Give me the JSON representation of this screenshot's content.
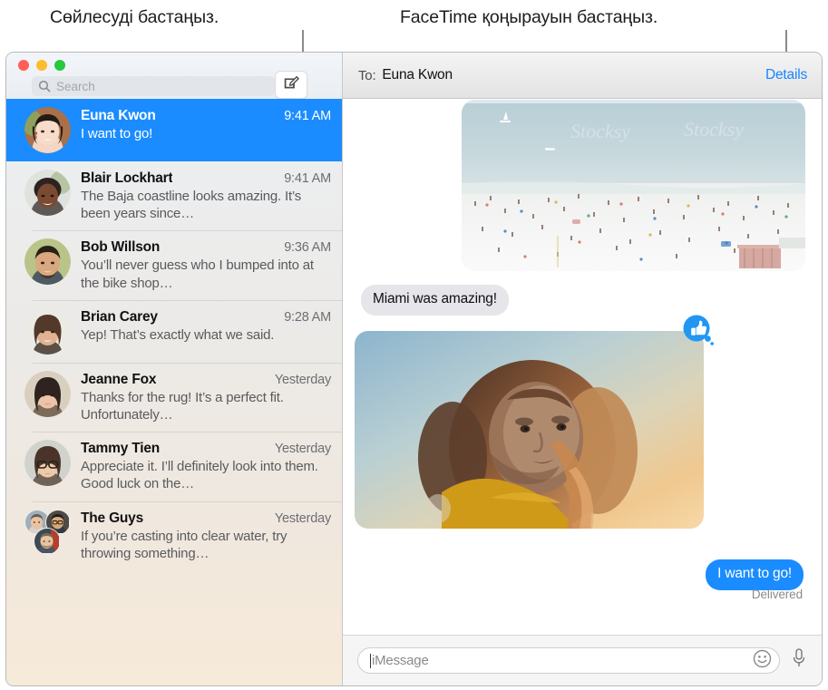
{
  "callouts": {
    "left": "Сөйлесуді бастаңыз.",
    "right": "FaceTime қоңырауын бастаңыз."
  },
  "window": {
    "traffic_lights": {
      "close_color": "#ff5f57",
      "minimize_color": "#febc2e",
      "zoom_color": "#28c840"
    }
  },
  "sidebar": {
    "search": {
      "placeholder": "Search",
      "icon": "search-icon"
    },
    "compose_button": {
      "icon": "compose-icon",
      "label": ""
    },
    "conversations": [
      {
        "name": "Euna Kwon",
        "time": "9:41 AM",
        "preview": "I want to go!",
        "selected": true,
        "avatar": "woman-dark-hair"
      },
      {
        "name": "Blair Lockhart",
        "time": "9:41 AM",
        "preview": "The Baja coastline looks amazing. It’s been years since…",
        "selected": false,
        "avatar": "woman-curly-hair"
      },
      {
        "name": "Bob Willson",
        "time": "9:36 AM",
        "preview": "You’ll never guess who I bumped into at the bike shop…",
        "selected": false,
        "avatar": "man-beard"
      },
      {
        "name": "Brian Carey",
        "time": "9:28 AM",
        "preview": "Yep! That’s exactly what we said.",
        "selected": false,
        "avatar": "man-long-hair"
      },
      {
        "name": "Jeanne Fox",
        "time": "Yesterday",
        "preview": "Thanks for the rug! It’s a perfect fit. Unfortunately…",
        "selected": false,
        "avatar": "woman-brown-hair"
      },
      {
        "name": "Tammy Tien",
        "time": "Yesterday",
        "preview": "Appreciate it. I’ll definitely look into them. Good luck on the…",
        "selected": false,
        "avatar": "woman-glasses"
      },
      {
        "name": "The Guys",
        "time": "Yesterday",
        "preview": "If you’re casting into clear water, try throwing something…",
        "selected": false,
        "avatar": "group-three-men"
      }
    ],
    "selection_color": "#1a8cff"
  },
  "conversation": {
    "to_label": "To:",
    "to_name": "Euna Kwon",
    "details_label": "Details",
    "details_color": "#1a84ff",
    "messages": [
      {
        "type": "photo",
        "side": "incoming",
        "description": "crowded-beach-photo"
      },
      {
        "type": "text",
        "side": "incoming",
        "text": "Miami was amazing!"
      },
      {
        "type": "photo",
        "side": "incoming",
        "description": "woman-sunset-portrait",
        "tapback": "thumbs-up"
      },
      {
        "type": "text",
        "side": "outgoing",
        "text": "I want to go!",
        "status": "Delivered"
      }
    ],
    "bubble_incoming_color": "#e5e5ea",
    "bubble_outgoing_color": "#1a8cff"
  },
  "input_bar": {
    "placeholder": "iMessage",
    "emoji_icon": "smiley-icon",
    "mic_icon": "microphone-icon"
  }
}
